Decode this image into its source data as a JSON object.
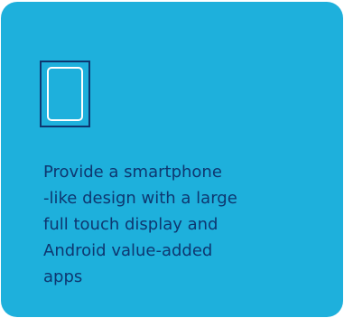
{
  "card": {
    "icon": "smartphone-icon",
    "description_lines": [
      "Provide a smartphone",
      "-like design with a large",
      "full touch display and",
      "Android value-added",
      "apps"
    ]
  },
  "colors": {
    "card_background": "#1eb0dc",
    "text": "#0e3770",
    "icon_frame": "#0e3770",
    "icon_stroke": "#ffffff"
  }
}
